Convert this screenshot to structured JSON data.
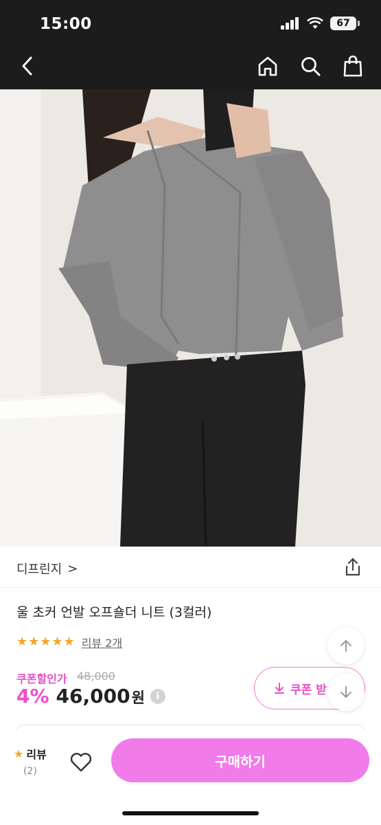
{
  "status_bar": {
    "time": "15:00",
    "battery": "67"
  },
  "nav": {
    "back_icon": "chevron-left-icon",
    "home_icon": "home-icon",
    "search_icon": "search-icon",
    "cart_icon": "shopping-bag-icon"
  },
  "brand": {
    "name": "디프린지",
    "chevron": ">"
  },
  "product": {
    "title": "울 초커 언발 오프숄더 니트 (3컬러)",
    "rating_stars": 5,
    "review_link": "리뷰 2개",
    "coupon_label": "쿠폰할인가",
    "original_price": "48,000",
    "discount": "4%",
    "price": "46,000",
    "currency": "원",
    "info_icon": "i"
  },
  "coupon_button": {
    "label": "쿠폰 받"
  },
  "bottom_bar": {
    "review_label": "리뷰",
    "review_count": "(2)",
    "buy_label": "구매하기"
  },
  "colors": {
    "accent_pink": "#f27bea",
    "discount_pink": "#ee4fcc",
    "star": "#f5a623",
    "header_bg": "#1c1c1c"
  }
}
